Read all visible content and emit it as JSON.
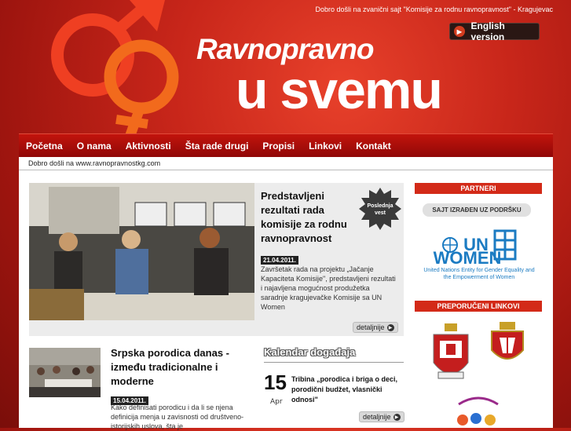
{
  "header": {
    "welcome_line": "Dobro došli na zvanični sajt \"Komisije za rodnu ravnopravnost\" - Kragujevac",
    "english_button": "English version",
    "title_line1": "Ravnopravno",
    "title_line2": "u svemu"
  },
  "nav": {
    "items": [
      "Početna",
      "O nama",
      "Aktivnosti",
      "Šta rade drugi",
      "Propisi",
      "Linkovi",
      "Kontakt"
    ]
  },
  "subbar": {
    "text": "Dobro došli na www.ravnopravnostkg.com"
  },
  "feature": {
    "title": "Predstavljeni rezultati rada komisije za rodnu ravnopravnost",
    "badge": "Poslednja vest",
    "date": "21.04.2011.",
    "text": "Završetak rada na projektu „Jačanje Kapaciteta Komisije\", predstavljeni rezultati i najavljena mogućnost produžetka saradnje kragujevačke Komisije sa UN Women",
    "more": "detaljnije"
  },
  "article2": {
    "title": "Srpska porodica danas - između tradicionalne i moderne",
    "date": "15.04.2011.",
    "text": "Kako definisati porodicu i da li se njena definicija menja u zavisnosti od društveno-istorijskih uslova, šta je"
  },
  "calendar": {
    "heading": "Kalendar događaja",
    "day": "15",
    "month": "Apr",
    "event": "Tribina „porodica i briga o deci, porodični budžet, vlasnički odnosi\"",
    "more": "detaljnije"
  },
  "sidebar": {
    "partners_heading": "PARTNERI",
    "support_button": "SAJT IZRAĐEN UZ PODRŠKU",
    "unwomen_line1": "UN",
    "unwomen_line2": "WOMEN",
    "unwomen_caption": "United Nations Entity for Gender Equality and the Empowerment of Women",
    "links_heading": "PREPORUČENI LINKOVI"
  },
  "colors": {
    "brand_red": "#d32a18",
    "nav_red": "#b0100a",
    "un_blue": "#1b7bc2"
  }
}
